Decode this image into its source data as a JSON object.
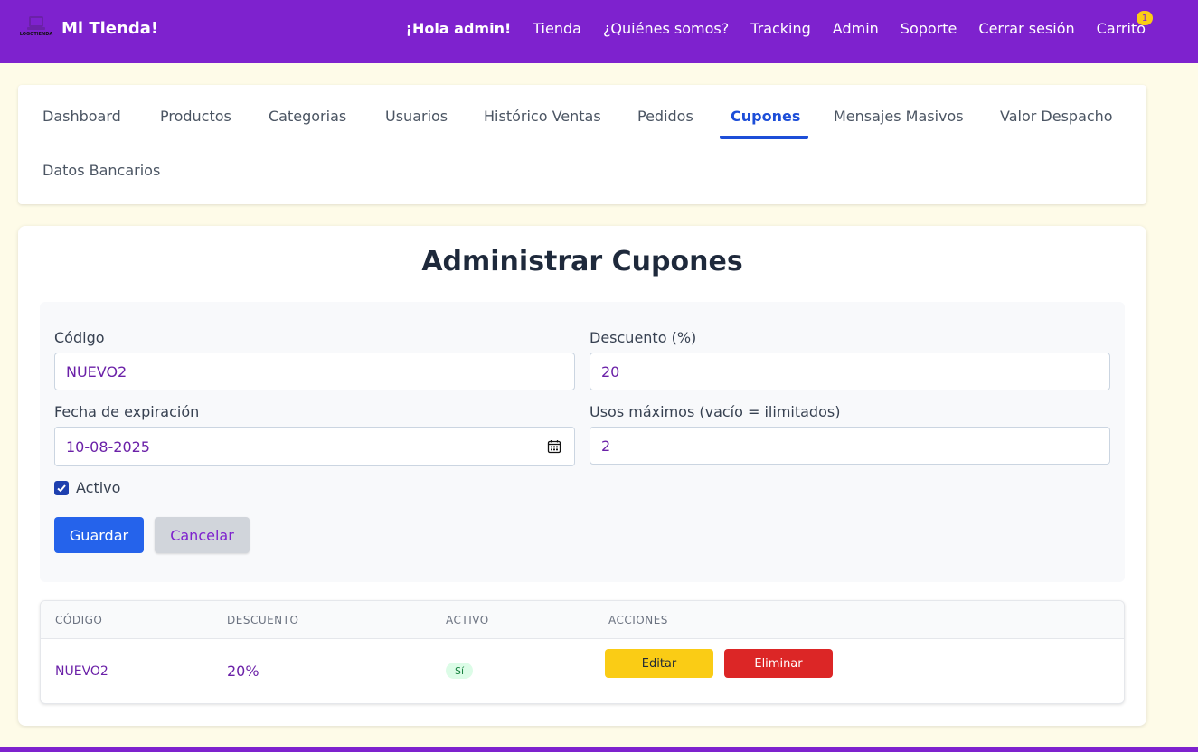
{
  "brand": {
    "logo_caption": "LOGOTIENDA",
    "name": "Mi Tienda!"
  },
  "nav": {
    "greeting": "¡Hola admin!",
    "items": [
      "Tienda",
      "¿Quiénes somos?",
      "Tracking",
      "Admin",
      "Soporte",
      "Cerrar sesión",
      "Carrito"
    ],
    "cart_count": "1"
  },
  "tabs": [
    "Dashboard",
    "Productos",
    "Categorias",
    "Usuarios",
    "Histórico Ventas",
    "Pedidos",
    "Cupones",
    "Mensajes Masivos",
    "Valor Despacho",
    "Datos Bancarios"
  ],
  "active_tab": "Cupones",
  "page": {
    "title": "Administrar Cupones"
  },
  "form": {
    "code_label": "Código",
    "code_value": "NUEVO2",
    "discount_label": "Descuento (%)",
    "discount_value": "20",
    "expiry_label": "Fecha de expiración",
    "expiry_value": "10-08-2025",
    "max_uses_label": "Usos máximos (vacío = ilimitados)",
    "max_uses_value": "2",
    "active_label": "Activo",
    "active_checked": true,
    "save_label": "Guardar",
    "cancel_label": "Cancelar"
  },
  "table": {
    "headers": [
      "CÓDIGO",
      "DESCUENTO",
      "ACTIVO",
      "ACCIONES"
    ],
    "rows": [
      {
        "code": "NUEVO2",
        "discount": "20%",
        "active": "Sí",
        "edit": "Editar",
        "delete": "Eliminar"
      }
    ]
  },
  "colors": {
    "brand": "#7e22ce",
    "accent": "#2563eb",
    "active_tab": "#1d4ed8",
    "background": "#fefbe8"
  }
}
